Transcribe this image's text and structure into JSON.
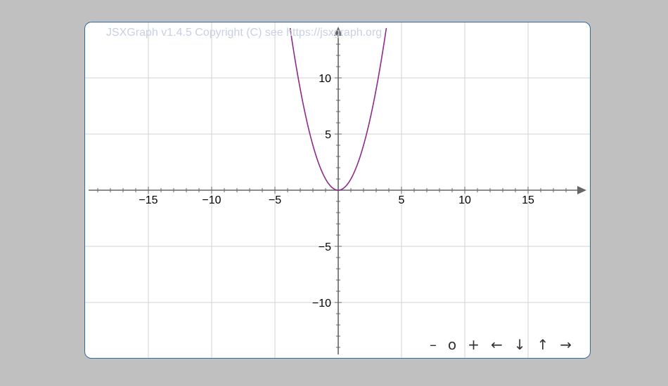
{
  "copyright": "JSXGraph v1.4.5 Copyright (C) see https://jsxgraph.org",
  "navbar": {
    "zoom_out": "–",
    "zoom_reset": "o",
    "zoom_in": "+",
    "left": "←",
    "down": "↓",
    "up": "↑",
    "right": "→"
  },
  "colors": {
    "curve": "#8b2b8b",
    "axis": "#666666",
    "grid": "#d0d0d0",
    "border": "#356aa0"
  },
  "chart_data": {
    "type": "line",
    "function": "y = x^2",
    "xlim": [
      -19.7,
      19.4
    ],
    "ylim": [
      -14.6,
      14.6
    ],
    "x_ticks": [
      -15,
      -10,
      -5,
      5,
      10,
      15
    ],
    "x_tick_labels": [
      "−15",
      "−10",
      "−5",
      "5",
      "10",
      "15"
    ],
    "y_ticks": [
      -10,
      -5,
      5,
      10
    ],
    "y_tick_labels": [
      "−10",
      "−5",
      "5",
      "10"
    ],
    "grid": true,
    "series": [
      {
        "x": [
          -3.8,
          -3,
          -2,
          -1,
          0,
          1,
          2,
          3,
          3.8
        ],
        "y": [
          14.44,
          9,
          4,
          1,
          0,
          1,
          4,
          9,
          14.44
        ]
      }
    ]
  }
}
